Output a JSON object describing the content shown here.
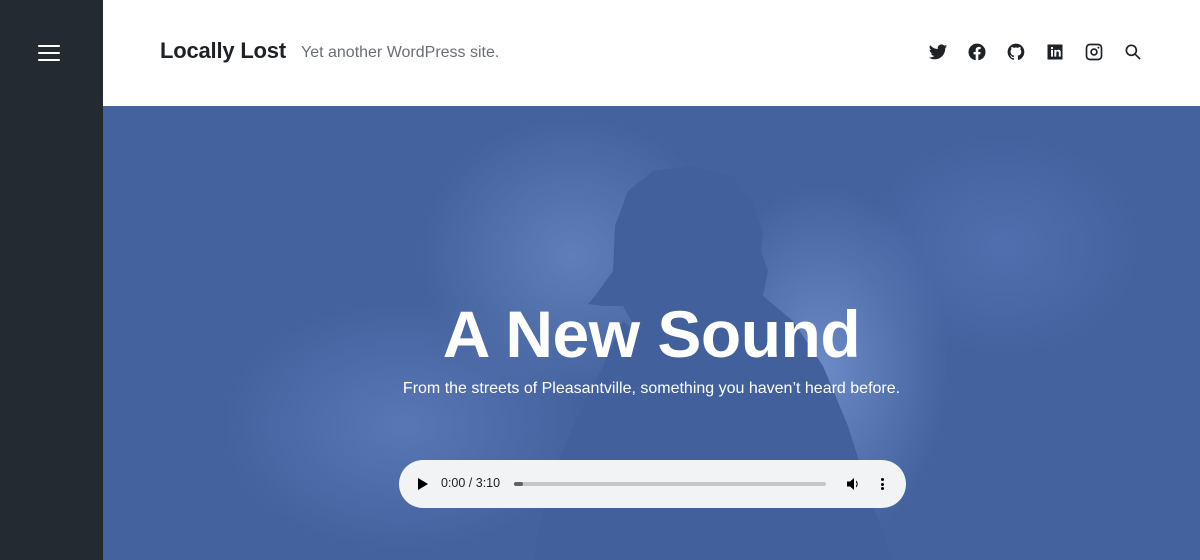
{
  "sidebar": {
    "menu_icon": "hamburger-menu-icon"
  },
  "header": {
    "site_title": "Locally Lost",
    "tagline": "Yet another WordPress site.",
    "social_icons": [
      "twitter-icon",
      "facebook-icon",
      "github-icon",
      "linkedin-icon",
      "instagram-icon",
      "search-icon"
    ]
  },
  "hero": {
    "title": "A New Sound",
    "subtitle": "From the streets of Pleasantville, something you haven’t heard before.",
    "background_color": "#44629e"
  },
  "audio_player": {
    "time_display": "0:00 / 3:10",
    "current_time": "0:00",
    "duration": "3:10",
    "progress_fraction": 0.02
  },
  "colors": {
    "sidebar": "#232a31",
    "text_dark": "#1e2226",
    "tagline": "#6b6f73",
    "player_bg": "#f1f3f4"
  }
}
